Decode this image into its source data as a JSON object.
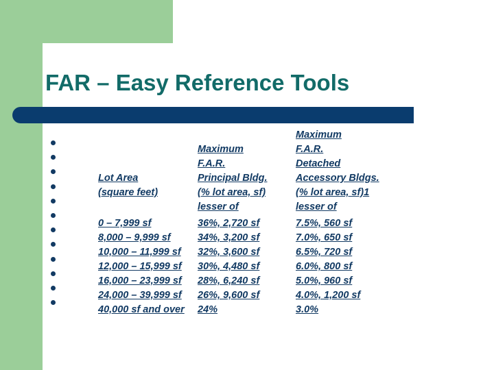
{
  "slide": {
    "title": "FAR – Easy Reference Tools",
    "colors": {
      "green": "#9BCE99",
      "navy_bar": "#0A3C6E",
      "title_teal": "#126B68",
      "table_text": "#123A63"
    },
    "bullet_count": 12
  },
  "table": {
    "headers": {
      "col1": [
        "Lot Area",
        "(square feet)"
      ],
      "col2": [
        "Maximum",
        "F.A.R.",
        " Principal Bldg.",
        "(% lot area, sf)",
        "lesser of"
      ],
      "col3": [
        "Maximum",
        "F.A.R.",
        "Detached",
        "Accessory Bldgs.",
        " (% lot area, sf)1",
        "lesser of"
      ]
    },
    "rows": [
      {
        "lot_area": "0 – 7,999 sf",
        "principal": "36%, 2,720 sf",
        "accessory": "7.5%, 560 sf"
      },
      {
        "lot_area": "8,000 – 9,999 sf",
        "principal": "34%, 3,200 sf",
        "accessory": "7.0%, 650 sf"
      },
      {
        "lot_area": "10,000 – 11,999 sf",
        "principal": "32%, 3,600 sf",
        "accessory": "6.5%, 720 sf"
      },
      {
        "lot_area": "12,000 – 15,999 sf",
        "principal": "30%, 4,480 sf",
        "accessory": "6.0%, 800 sf"
      },
      {
        "lot_area": "16,000 – 23,999 sf",
        "principal": "28%, 6,240 sf",
        "accessory": "5.0%, 960 sf"
      },
      {
        "lot_area": "24,000 – 39,999 sf",
        "principal": "26%, 9,600 sf",
        "accessory": "4.0%, 1,200 sf"
      },
      {
        "lot_area": "40,000 sf and over",
        "principal": "24%",
        "accessory": "3.0%"
      }
    ]
  }
}
